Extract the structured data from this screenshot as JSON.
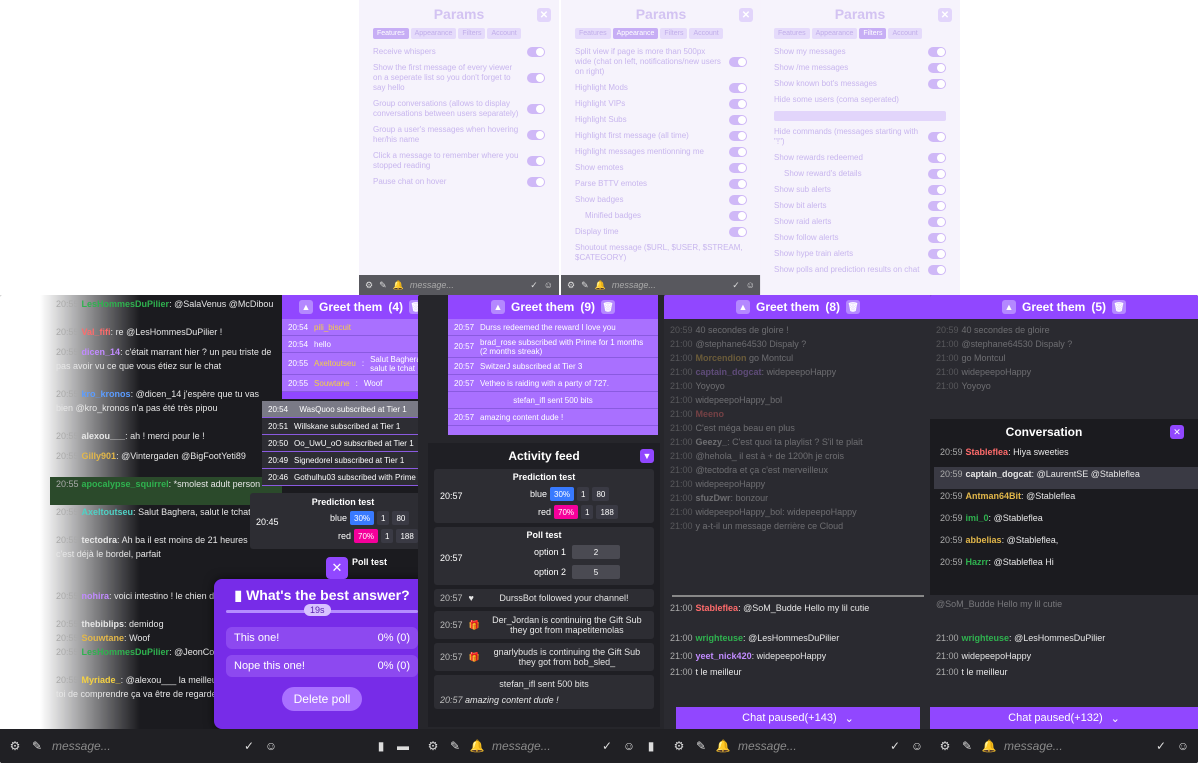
{
  "params": {
    "title": "Params",
    "tabs": [
      "Features",
      "Appearance",
      "Filters",
      "Account"
    ],
    "features": [
      "Receive whispers",
      "Show the first message of every viewer on a seperate list so you don't forget to say hello",
      "Group conversations (allows to display conversations between users separately)",
      "Group a user's messages when hovering her/his name",
      "Click a message to remember where you stopped reading",
      "Pause chat on hover"
    ],
    "appearance": [
      "Split view if page is more than 500px wide (chat on left, notifications/new users on right)",
      "Highlight Mods",
      "Highlight VIPs",
      "Highlight Subs",
      "Highlight first message (all time)",
      "Highlight messages mentionning me",
      "Show emotes",
      "Parse BTTV emotes",
      "Show badges",
      "Minified badges",
      "Display time",
      "Shoutout message ($URL, $USER, $STREAM, $CATEGORY)"
    ],
    "filters": [
      "Show my messages",
      "Show /me messages",
      "Show known bot's messages",
      "Hide some users (coma seperated)",
      "Hide commands (messages starting with \"!\")",
      "Show rewards redeemed",
      "Show reward's details",
      "Show sub alerts",
      "Show bit alerts",
      "Show raid alerts",
      "Show follow alerts",
      "Show hype train alerts",
      "Show polls and prediction results on chat"
    ],
    "message_placeholder": "message..."
  },
  "chat_left": [
    {
      "time": "20:55",
      "user": "LesHommesDuPilier",
      "text": "@SalaVenus @McDibou"
    },
    {
      "time": "20:55",
      "user": "Val_fifi",
      "text": "re @LesHommesDuPilier !"
    },
    {
      "time": "20:55",
      "user": "dicen_14",
      "text": "c'était marrant hier ? un peu triste de pas avoir vu ce que vous étiez sur le chat"
    },
    {
      "time": "20:55",
      "user": "kro_kronos",
      "text": "@dicen_14 j'espère que tu vas bien @kro_kronos n'a pas été très pipou"
    },
    {
      "time": "20:55",
      "user": "alexou___",
      "text": "ah ! merci pour le !"
    },
    {
      "time": "20:55",
      "user": "Gilly901",
      "text": "@Vintergaden @BigFootYeti89"
    },
    {
      "time": "20:55",
      "user": "apocalypse_squirrel",
      "text": "*smolest adult person"
    },
    {
      "time": "20:55",
      "user": "Axeltoutseu",
      "text": "Salut Baghera, salut le tchat"
    },
    {
      "time": "20:55",
      "user": "tectodra",
      "text": "Ah ba il est moins de 21 heures et c'est déjà le bordel, parfait"
    },
    {
      "time": "20:55",
      "user": "nohira",
      "text": "voici intestino ! le chien de colas"
    },
    {
      "time": "20:55",
      "user": "thebiblips",
      "text": "demidog"
    },
    {
      "time": "20:55",
      "user": "Souwtane",
      "text": "Woof"
    },
    {
      "time": "20:55",
      "user": "LesHommesDuPilier",
      "text": "@JeonCostex"
    },
    {
      "time": "20:55",
      "user": "Myriade_",
      "text": "@alexou___ la meilleure façon pour toi de comprendre ça va être de regarder la redif!"
    }
  ],
  "greet1": {
    "title": "Greet them",
    "count": "(4)",
    "items": [
      {
        "time": "20:54",
        "user": "pili_biscuit",
        "text": ""
      },
      {
        "time": "20:54",
        "user": "",
        "text": "hello"
      },
      {
        "time": "20:55",
        "user": "Axeltoutseu",
        "text": "Salut Baghera, salut le tchat"
      },
      {
        "time": "20:55",
        "user": "Souwtane",
        "text": "Woof"
      }
    ]
  },
  "subs": [
    {
      "time": "20:54",
      "text": "WasQuoo subscribed at Tier 1"
    },
    {
      "time": "20:51",
      "text": "Willskane subscribed at Tier 1"
    },
    {
      "time": "20:50",
      "text": "Oo_UwU_oO subscribed at Tier 1"
    },
    {
      "time": "20:49",
      "text": "Signedorel subscribed at Tier 1"
    },
    {
      "time": "20:46",
      "text": "Gothulhu03 subscribed with Prime"
    }
  ],
  "prediction": {
    "title": "Prediction test",
    "time": "20:45",
    "outcomes": [
      {
        "label": "blue",
        "pct": "30%",
        "users": "1",
        "points": "80"
      },
      {
        "label": "red",
        "pct": "70%",
        "users": "1",
        "points": "188"
      }
    ]
  },
  "poll_overlay": {
    "question": "What's the best answer?",
    "timer": "19s",
    "options": [
      {
        "label": "This one!",
        "value": "0% (0)"
      },
      {
        "label": "Nope this one!",
        "value": "0% (0)"
      }
    ],
    "delete": "Delete poll",
    "behind": "Poll test"
  },
  "greet2": {
    "title": "Greet them",
    "count": "(9)",
    "items": [
      {
        "time": "20:57",
        "text": "Durss redeemed the reward I love you"
      },
      {
        "time": "20:57",
        "text": "brad_rose subscribed with Prime for 1 months (2 months streak)"
      },
      {
        "time": "20:57",
        "text": "SwitzerJ subscribed at Tier 3"
      },
      {
        "time": "20:57",
        "text": "Vetheo is raiding with a party of 727."
      },
      {
        "time": "",
        "text": "stefan_ifl sent 500 bits"
      },
      {
        "time": "20:57",
        "text": "amazing content dude !"
      }
    ]
  },
  "activity": {
    "title": "Activity feed",
    "prediction": {
      "title": "Prediction test",
      "time": "20:57",
      "outcomes": [
        {
          "label": "blue",
          "pct": "30%",
          "users": "1",
          "points": "80"
        },
        {
          "label": "red",
          "pct": "70%",
          "users": "1",
          "points": "188"
        }
      ]
    },
    "poll": {
      "title": "Poll test",
      "time": "20:57",
      "options": [
        {
          "label": "option 1",
          "votes": "2"
        },
        {
          "label": "option 2",
          "votes": "5"
        }
      ]
    },
    "items": [
      {
        "time": "20:57",
        "text": "DurssBot followed your channel!"
      },
      {
        "time": "20:57",
        "text": "Der_Jordan is continuing the Gift Sub they got from mapetitemolas"
      },
      {
        "time": "20:57",
        "text": "gnarlybuds is continuing the Gift Sub they got from bob_sled_"
      },
      {
        "time": "20:57",
        "text": "stefan_ifl sent 500 bits"
      },
      {
        "time": "",
        "text": "amazing content dude !"
      }
    ]
  },
  "greet3": {
    "title": "Greet them",
    "count": "(8)"
  },
  "greet4": {
    "title": "Greet them",
    "count": "(5)"
  },
  "chat3": [
    {
      "time": "20:59",
      "user": "",
      "text": "40 secondes de gloire !"
    },
    {
      "time": "21:00",
      "user": "",
      "text": "@stephane64530 Dispaly ?"
    },
    {
      "time": "21:00",
      "user": "Morcendion",
      "text": "go Montcul"
    },
    {
      "time": "21:00",
      "user": "captain_dogcat",
      "text": "widepeepoHappy"
    },
    {
      "time": "21:00",
      "user": "",
      "text": "Yoyoyo"
    },
    {
      "time": "21:00",
      "user": "",
      "text": "widepeepoHappy_bol"
    },
    {
      "time": "21:00",
      "user": "Meeno",
      "text": ""
    },
    {
      "time": "21:00",
      "user": "",
      "text": "C'est méga beau en plus"
    },
    {
      "time": "21:00",
      "user": "Geezy_",
      "text": "C'est quoi ta playlist ? S'il te plait"
    },
    {
      "time": "21:00",
      "user": "",
      "text": "@hehola_ il est à + de 1200h je crois"
    },
    {
      "time": "21:00",
      "user": "",
      "text": "@tectodra et ça c'est merveilleux"
    },
    {
      "time": "21:00",
      "user": "",
      "text": "widepeepoHappy"
    },
    {
      "time": "21:00",
      "user": "sfuzDwr",
      "text": "bonzour"
    },
    {
      "time": "21:00",
      "user": "",
      "text": "widepeepoHappy_bol",
      "extra": "widepeepoHappy"
    },
    {
      "time": "21:00",
      "user": "",
      "text": "y a-t-il un message derrière ce Cloud"
    }
  ],
  "chat3_bottom": [
    {
      "time": "21:00",
      "user": "Stableflea",
      "text": "@SoM_Budde Hello my lil cutie"
    },
    {
      "time": "21:00",
      "user": "wrighteuse",
      "text": "@LesHommesDuPilier"
    },
    {
      "time": "21:00",
      "user": "yeet_nick420",
      "text": "widepeepoHappy"
    },
    {
      "time": "21:00",
      "user": "",
      "text": "t le meilleur"
    }
  ],
  "conversation": {
    "title": "Conversation",
    "items": [
      {
        "time": "20:59",
        "user": "Stableflea",
        "text": "Hiya sweeties"
      },
      {
        "time": "20:59",
        "user": "captain_dogcat",
        "text": "@LaurentSE @Stableflea"
      },
      {
        "time": "20:59",
        "user": "Antman64Bit",
        "text": "@Stableflea"
      },
      {
        "time": "20:59",
        "user": "imi_0",
        "text": "@Stableflea"
      },
      {
        "time": "20:59",
        "user": "abbelias",
        "text": "@Stableflea,"
      },
      {
        "time": "20:59",
        "user": "Hazrr",
        "text": "@Stableflea Hi"
      }
    ]
  },
  "chat4_top": [
    {
      "time": "20:59",
      "text": "40 secondes de gloire"
    },
    {
      "time": "21:00",
      "text": "@stephane64530 Dispaly ?"
    },
    {
      "time": "21:00",
      "text": "go Montcul"
    },
    {
      "time": "21:00",
      "text": "widepeepoHappy"
    },
    {
      "time": "21:00",
      "text": "Yoyoyo"
    }
  ],
  "chat4_bottom": [
    {
      "time": "",
      "text": "@SoM_Budde Hello my lil cutie"
    },
    {
      "time": "21:00",
      "user": "wrighteuse",
      "text": "@LesHommesDuPilier"
    },
    {
      "time": "21:00",
      "user": "",
      "text": "widepeepoHappy"
    },
    {
      "time": "21:00",
      "user": "",
      "text": "t le meilleur"
    }
  ],
  "paused3": "Chat paused(+143)",
  "paused4": "Chat paused(+132)",
  "message_placeholder": "message..."
}
